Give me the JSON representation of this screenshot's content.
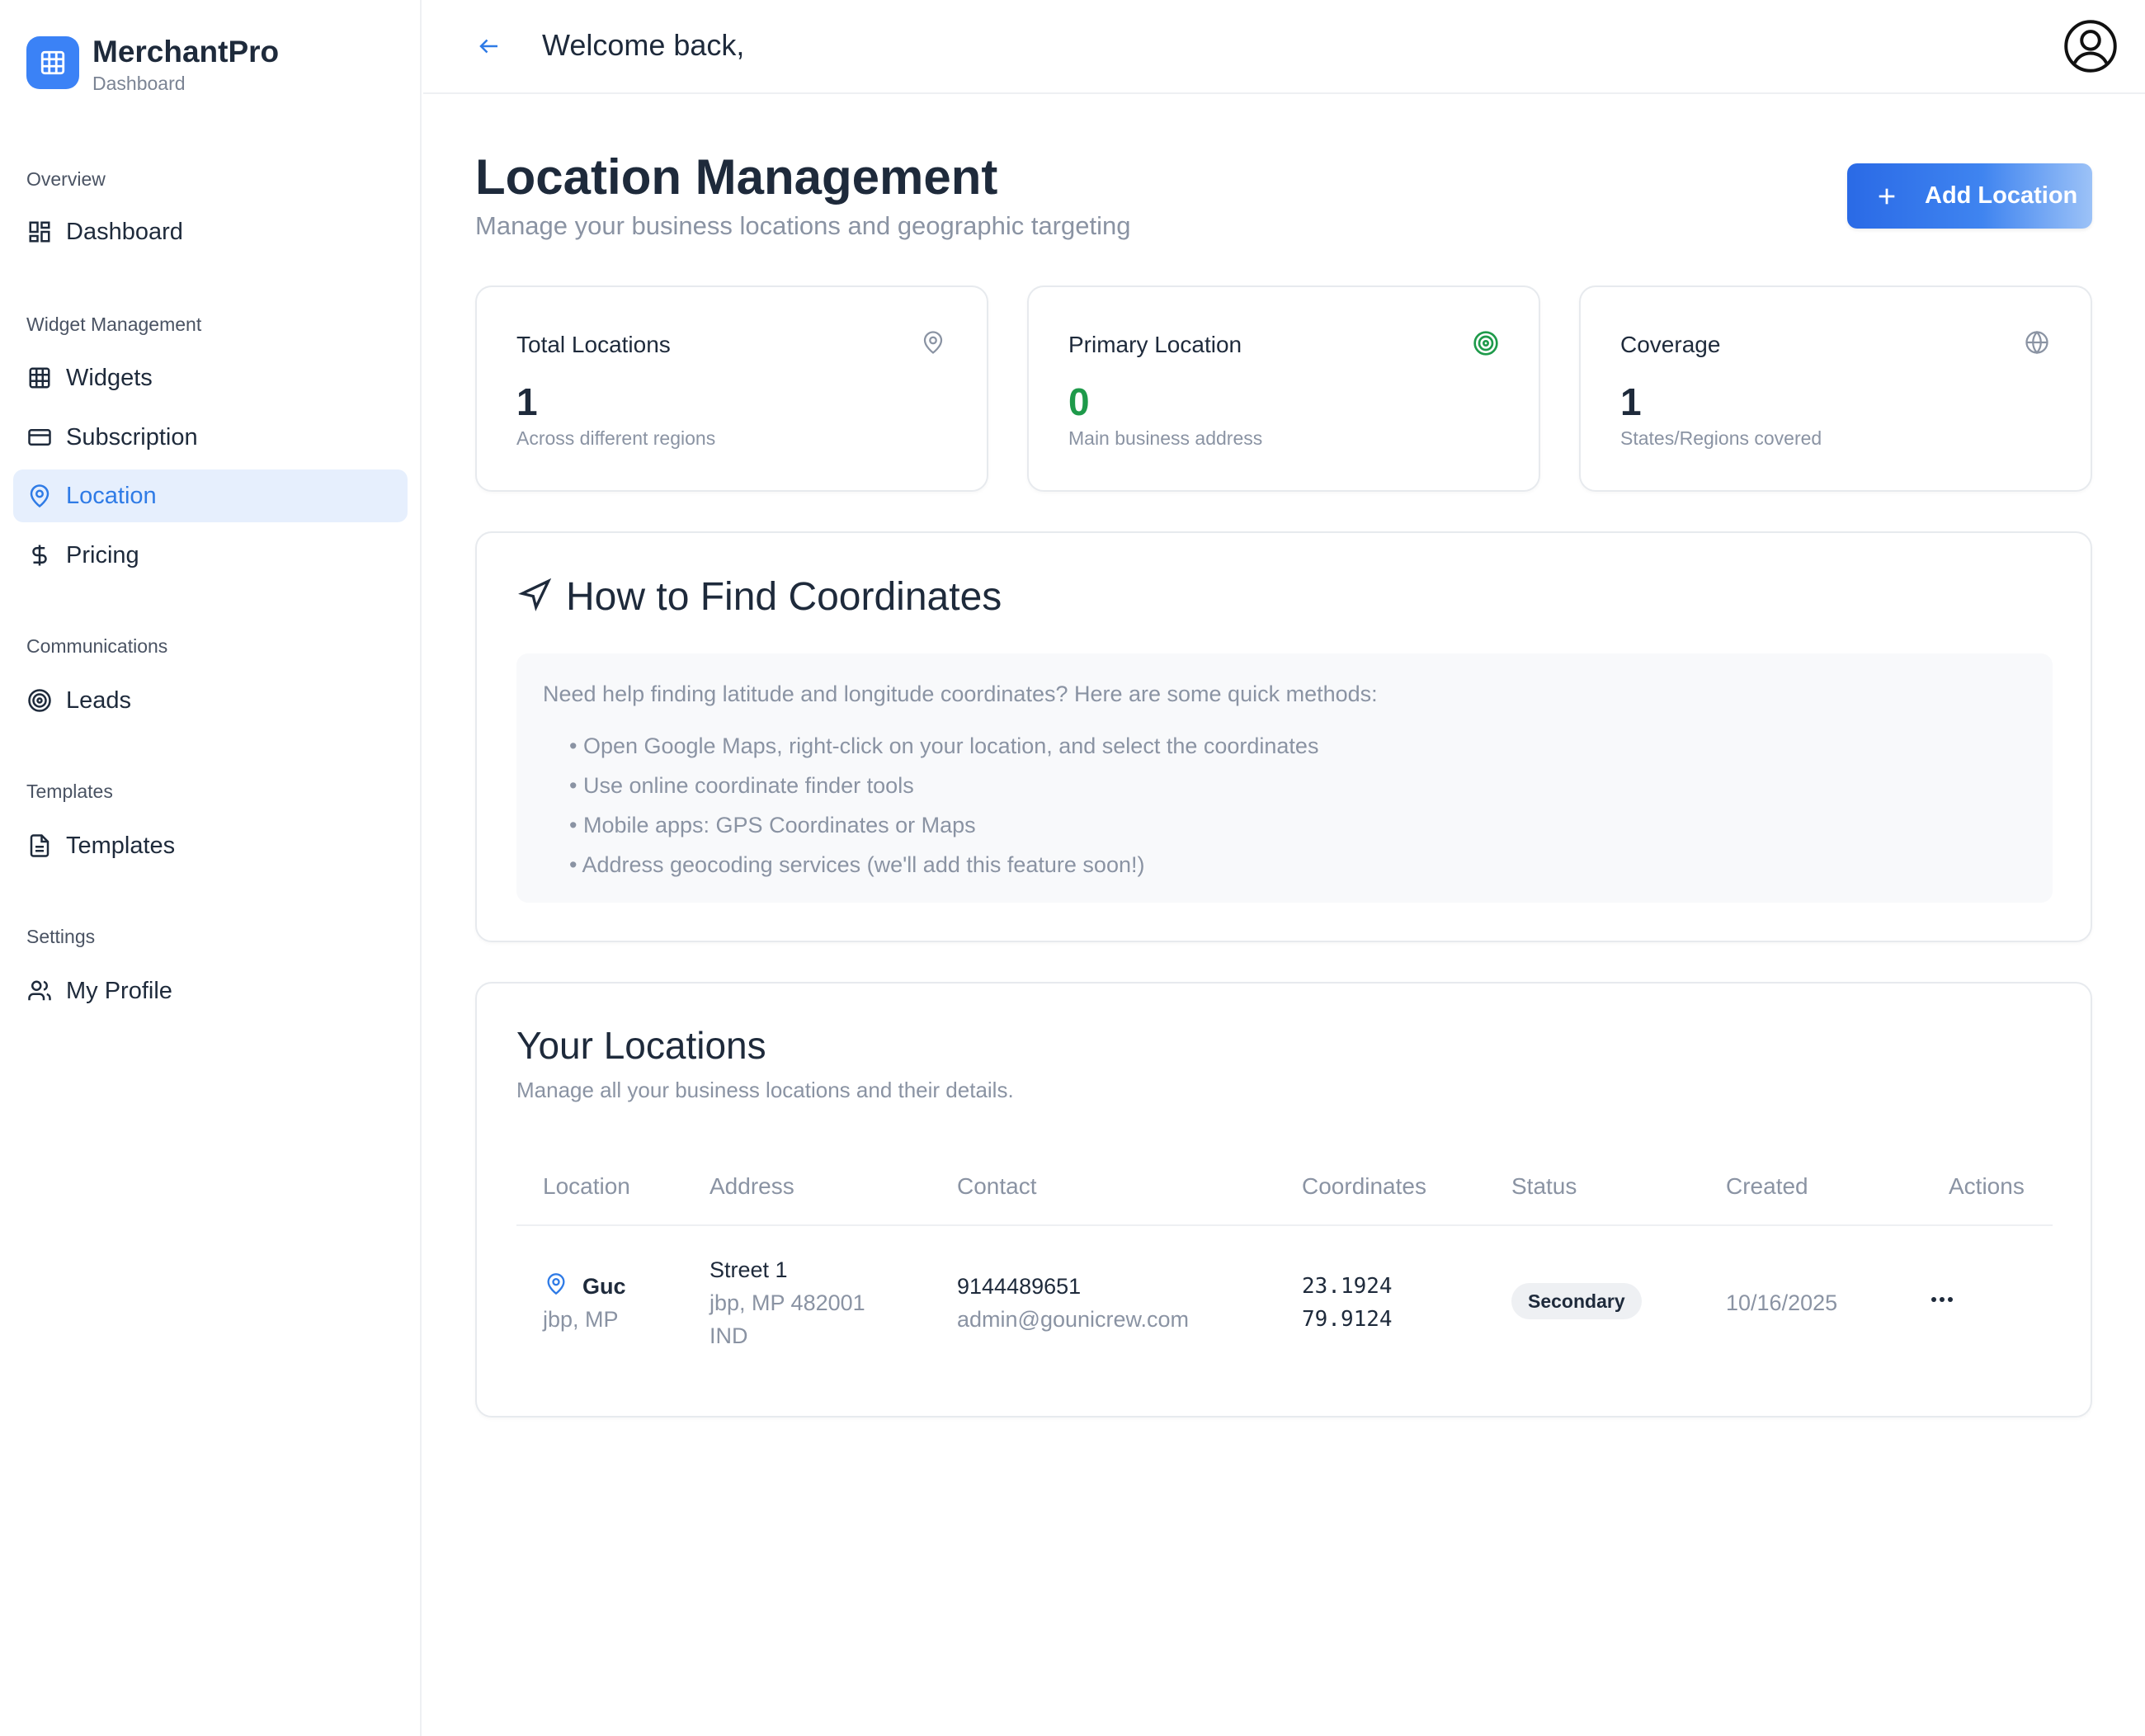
{
  "brand": {
    "name": "MerchantPro",
    "subtitle": "Dashboard",
    "logo_icon": "grid-icon",
    "accent": "#3b82f6"
  },
  "sidebar": {
    "sections": [
      {
        "title": "Overview",
        "items": [
          {
            "label": "Dashboard",
            "icon": "dashboard-icon"
          }
        ]
      },
      {
        "title": "Widget Management",
        "items": [
          {
            "label": "Widgets",
            "icon": "grid-icon"
          },
          {
            "label": "Subscription",
            "icon": "credit-card-icon"
          },
          {
            "label": "Location",
            "icon": "map-pin-icon",
            "active": true
          },
          {
            "label": "Pricing",
            "icon": "dollar-icon"
          }
        ]
      },
      {
        "title": "Communications",
        "items": [
          {
            "label": "Leads",
            "icon": "target-icon"
          }
        ]
      },
      {
        "title": "Templates",
        "items": [
          {
            "label": "Templates",
            "icon": "document-icon"
          }
        ]
      },
      {
        "title": "Settings",
        "items": [
          {
            "label": "My Profile",
            "icon": "users-icon"
          }
        ]
      }
    ]
  },
  "header": {
    "welcome": "Welcome back,",
    "back_icon": "arrow-left-icon",
    "avatar_icon": "user-circle-icon"
  },
  "page": {
    "title": "Location Management",
    "subtitle": "Manage your business locations and geographic targeting",
    "add_button": "Add Location"
  },
  "stats": [
    {
      "label": "Total Locations",
      "value": "1",
      "desc": "Across different regions",
      "icon": "map-pin-icon"
    },
    {
      "label": "Primary Location",
      "value": "0",
      "desc": "Main business address",
      "icon": "target-icon",
      "color": "#1e9a4a"
    },
    {
      "label": "Coverage",
      "value": "1",
      "desc": "States/Regions covered",
      "icon": "globe-icon"
    }
  ],
  "howto": {
    "title": "How to Find Coordinates",
    "intro": "Need help finding latitude and longitude coordinates? Here are some quick methods:",
    "items": [
      "• Open Google Maps, right-click on your location, and select the coordinates",
      "• Use online coordinate finder tools",
      "• Mobile apps: GPS Coordinates or Maps",
      "• Address geocoding services (we'll add this feature soon!)"
    ]
  },
  "locations": {
    "title": "Your Locations",
    "subtitle": "Manage all your business locations and their details.",
    "columns": [
      "Location",
      "Address",
      "Contact",
      "Coordinates",
      "Status",
      "Created",
      "Actions"
    ],
    "rows": [
      {
        "name": "Guc",
        "city": "jbp, MP",
        "street": "Street 1",
        "city_zip": "jbp, MP 482001",
        "country": "IND",
        "phone": "9144489651",
        "email": "admin@gounicrew.com",
        "lat": "23.1924",
        "lng": "79.9124",
        "status": "Secondary",
        "created": "10/16/2025"
      }
    ]
  }
}
